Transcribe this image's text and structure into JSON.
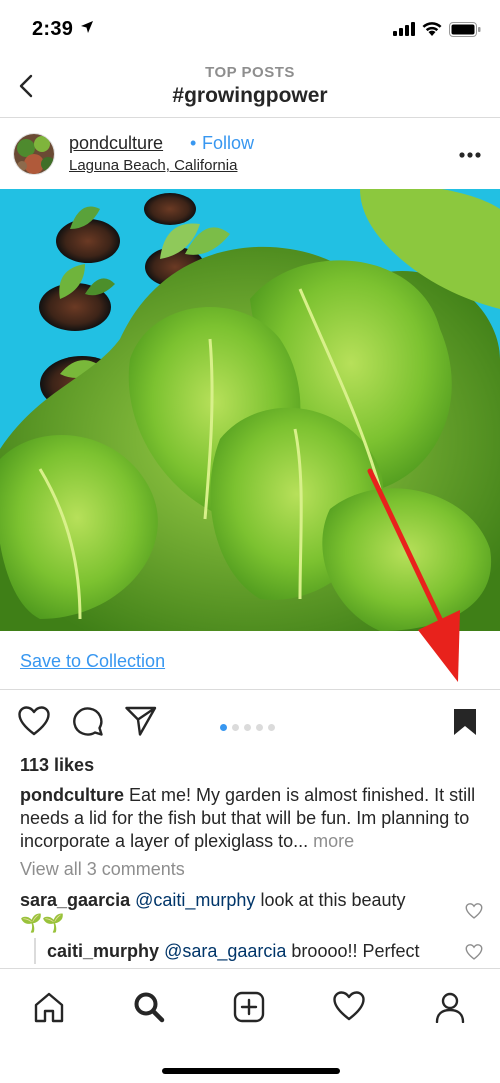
{
  "status_bar": {
    "time": "2:39"
  },
  "header": {
    "subtitle": "TOP POSTS",
    "title": "#growingpower"
  },
  "post": {
    "username": "pondculture",
    "follow_separator": "•",
    "follow_label": "Follow",
    "location": "Laguna Beach, California"
  },
  "save_collection": {
    "label": "Save to Collection"
  },
  "carousel": {
    "count": 5,
    "active": 1
  },
  "likes": "113 likes",
  "caption": {
    "username": "pondculture",
    "text": "Eat me!  My garden is almost finished. It still needs a lid for the fish but that will be fun. Im planning to incorporate a layer of plexiglass to...",
    "more": "more"
  },
  "view_comments": "View all 3 comments",
  "comments": [
    {
      "username": "sara_gaarcia",
      "mention": "@caiti_murphy",
      "text": "look at this beauty",
      "emoji": "🌱🌱"
    },
    {
      "username": "caiti_murphy",
      "mention": "@sara_gaarcia",
      "text": "broooo!! Perfect"
    }
  ],
  "colors": {
    "link_blue": "#3897f0",
    "annotation_arrow": "#e8221c",
    "divider": "#dbdbdb",
    "muted_text": "#8e8e8e"
  },
  "icons": {
    "nav": "back-chevron-icon",
    "actions": [
      "heart-icon",
      "comment-icon",
      "share-icon",
      "bookmark-filled-icon"
    ],
    "tabs": [
      "home-icon",
      "search-icon",
      "add-post-icon",
      "activity-heart-icon",
      "profile-icon"
    ]
  }
}
